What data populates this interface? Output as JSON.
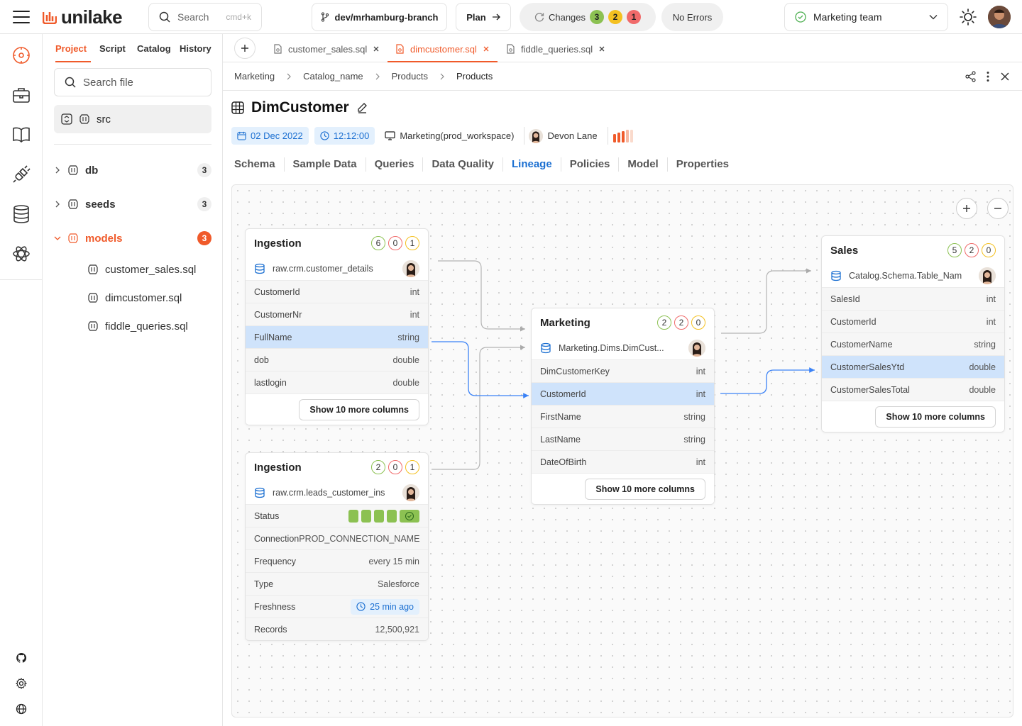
{
  "app": {
    "brand": "unilake",
    "brand_color": "#f05a2a",
    "accent_color": "#1b6fd1"
  },
  "topbar": {
    "search_label": "Search",
    "search_shortcut": "cmd+k",
    "branch": "dev/mrhamburg-branch",
    "plan_label": "Plan",
    "changes_label": "Changes",
    "changes_counts": [
      "3",
      "2",
      "1"
    ],
    "errors_label": "No Errors",
    "team": "Marketing team"
  },
  "panel": {
    "tabs": [
      "Project",
      "Script",
      "Catalog",
      "History"
    ],
    "active_tab": "Project",
    "search_placeholder": "Search file",
    "root": "src",
    "folders": [
      {
        "name": "db",
        "count": "3",
        "expanded": false
      },
      {
        "name": "seeds",
        "count": "3",
        "expanded": false
      },
      {
        "name": "models",
        "count": "3",
        "expanded": true
      }
    ],
    "files": [
      "customer_sales.sql",
      "dimcustomer.sql",
      "fiddle_queries.sql"
    ]
  },
  "editor_tabs": [
    {
      "label": "customer_sales.sql",
      "active": false
    },
    {
      "label": "dimcustomer.sql",
      "active": true
    },
    {
      "label": "fiddle_queries.sql",
      "active": false
    }
  ],
  "breadcrumb": [
    "Marketing",
    "Catalog_name",
    "Products",
    "Products"
  ],
  "entity": {
    "title": "DimCustomer",
    "date": "02 Dec 2022",
    "time": "12:12:00",
    "workspace": "Marketing(prod_workspace)",
    "owner": "Devon Lane",
    "tabs": [
      "Schema",
      "Sample Data",
      "Queries",
      "Data Quality",
      "Lineage",
      "Policies",
      "Model",
      "Properties"
    ],
    "active_tab": "Lineage"
  },
  "lineage": {
    "ingestion1": {
      "title": "Ingestion",
      "badges": [
        "6",
        "0",
        "1"
      ],
      "source": "raw.crm.customer_details",
      "columns": [
        {
          "name": "CustomerId",
          "type": "int"
        },
        {
          "name": "CustomerNr",
          "type": "int"
        },
        {
          "name": "FullName",
          "type": "string"
        },
        {
          "name": "dob",
          "type": "double"
        },
        {
          "name": "lastlogin",
          "type": "double"
        }
      ],
      "more": "Show 10 more columns"
    },
    "ingestion2": {
      "title": "Ingestion",
      "badges": [
        "2",
        "0",
        "1"
      ],
      "source": "raw.crm.leads_customer_ins",
      "props": {
        "status_label": "Status",
        "connection_label": "Connection",
        "connection": "PROD_CONNECTION_NAME",
        "frequency_label": "Frequency",
        "frequency": "every 15 min",
        "type_label": "Type",
        "type": "Salesforce",
        "freshness_label": "Freshness",
        "freshness": "25 min ago",
        "records_label": "Records",
        "records": "12,500,921"
      }
    },
    "marketing": {
      "title": "Marketing",
      "badges": [
        "2",
        "2",
        "0"
      ],
      "source": "Marketing.Dims.DimCust...",
      "columns": [
        {
          "name": "DimCustomerKey",
          "type": "int"
        },
        {
          "name": "CustomerId",
          "type": "int"
        },
        {
          "name": "FirstName",
          "type": "string"
        },
        {
          "name": "LastName",
          "type": "string"
        },
        {
          "name": "DateOfBirth",
          "type": "int"
        }
      ],
      "more": "Show 10 more columns"
    },
    "sales": {
      "title": "Sales",
      "badges": [
        "5",
        "2",
        "0"
      ],
      "source": "Catalog.Schema.Table_Nam",
      "columns": [
        {
          "name": "SalesId",
          "type": "int"
        },
        {
          "name": "CustomerId",
          "type": "int"
        },
        {
          "name": "CustomerName",
          "type": "string"
        },
        {
          "name": "CustomerSalesYtd",
          "type": "double"
        },
        {
          "name": "CustomerSalesTotal",
          "type": "double"
        }
      ],
      "more": "Show 10 more columns"
    }
  }
}
